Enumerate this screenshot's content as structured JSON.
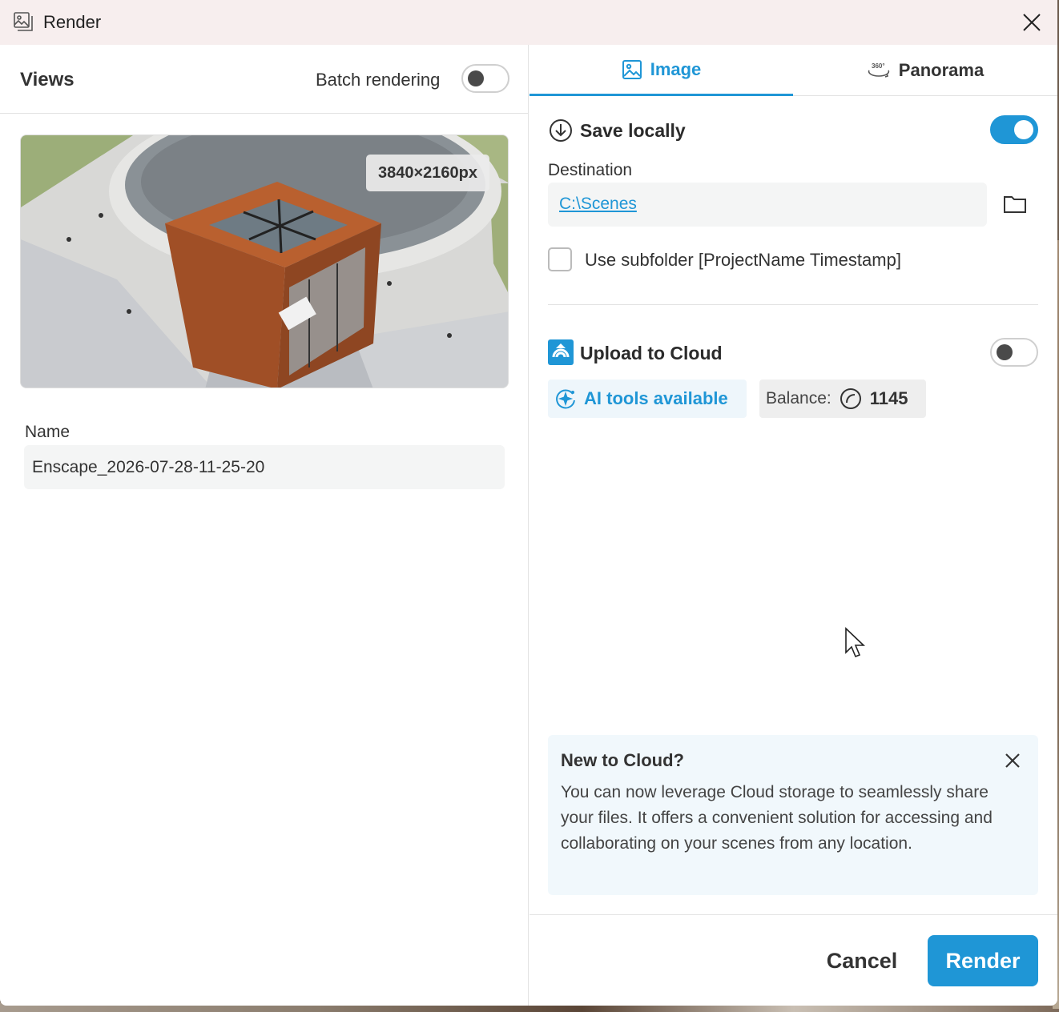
{
  "window": {
    "title": "Render"
  },
  "left": {
    "views_title": "Views",
    "batch_label": "Batch rendering",
    "batch_enabled": false,
    "resolution": "3840×2160px",
    "name_label": "Name",
    "name_value": "Enscape_2026-07-28-11-25-20"
  },
  "tabs": [
    {
      "label": "Image",
      "icon": "image-icon",
      "active": true
    },
    {
      "label": "Panorama",
      "icon": "panorama-360-icon",
      "active": false
    }
  ],
  "save_locally": {
    "title": "Save locally",
    "enabled": true,
    "destination_label": "Destination",
    "destination_value": "C:\\Scenes",
    "subfolder_label": "Use subfolder [ProjectName Timestamp]",
    "subfolder_checked": false
  },
  "cloud": {
    "title": "Upload to Cloud",
    "enabled": false,
    "ai_label": "AI tools available",
    "balance_label": "Balance:",
    "balance_value": "1145"
  },
  "info": {
    "title": "New to Cloud?",
    "text": "You can now leverage Cloud storage to seamlessly share your files. It offers a convenient solution for accessing and collaborating on your scenes from any location."
  },
  "footer": {
    "cancel_label": "Cancel",
    "render_label": "Render"
  },
  "colors": {
    "accent": "#1f96d6",
    "titlebar": "#f7eeee"
  }
}
